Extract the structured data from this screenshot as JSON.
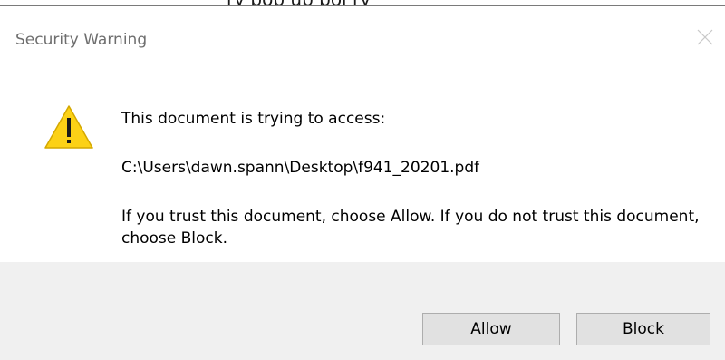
{
  "background_text": "ry pop up pol   ry",
  "dialog": {
    "title": "Security Warning",
    "close_icon": "close-icon",
    "warning_icon": "warning-triangle-icon",
    "heading": "This document is trying to access:",
    "path": "C:\\Users\\dawn.spann\\Desktop\\f941_20201.pdf",
    "advice": "If you trust this document, choose Allow. If you do not trust this document, choose Block.",
    "buttons": {
      "allow": "Allow",
      "block": "Block"
    }
  },
  "colors": {
    "warning_yellow": "#fcd116",
    "footer_bg": "#f0f0f0",
    "button_bg": "#e1e1e1",
    "button_border": "#adadad",
    "title_text": "#6e6e6e"
  }
}
